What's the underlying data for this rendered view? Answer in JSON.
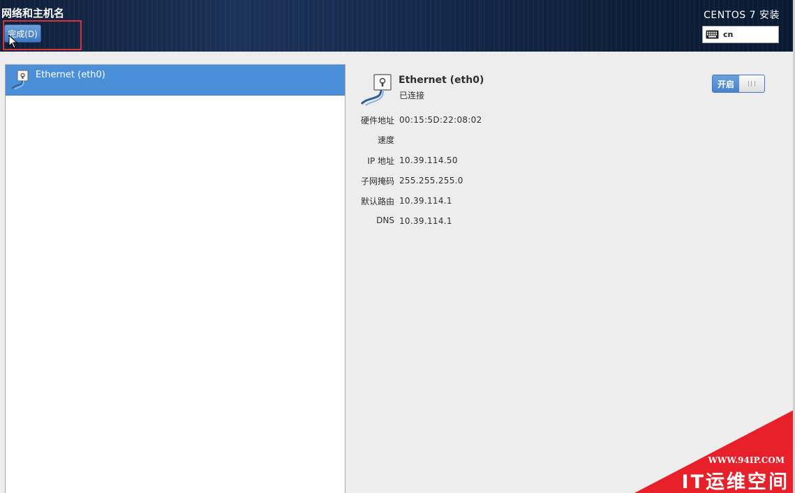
{
  "header": {
    "page_title": "网络和主机名",
    "done_button_label": "完成(D)",
    "product_title": "CENTOS 7 安装",
    "keyboard_layout": "cn",
    "keyboard_icon": "keyboard-icon"
  },
  "device_list": {
    "items": [
      {
        "label": "Ethernet (eth0)",
        "icon": "ethernet-cable-icon",
        "selected": true
      }
    ]
  },
  "device_detail": {
    "icon": "ethernet-cable-icon",
    "name": "Ethernet (eth0)",
    "status": "已连接",
    "toggle_label": "开启",
    "toggle_on": true,
    "properties": [
      {
        "label": "硬件地址",
        "value": "00:15:5D:22:08:02"
      },
      {
        "label": "速度",
        "value": ""
      },
      {
        "label": "IP 地址",
        "value": "10.39.114.50"
      },
      {
        "label": "子网掩码",
        "value": "255.255.255.0"
      },
      {
        "label": "默认路由",
        "value": "10.39.114.1"
      },
      {
        "label": "DNS",
        "value": "10.39.114.1"
      }
    ]
  },
  "watermark": {
    "url": "WWW.94IP.COM",
    "brand": "IT运维空间"
  },
  "colors": {
    "accent": "#4a8fd8",
    "highlight": "#d9343a",
    "watermark": "#e8202a"
  }
}
